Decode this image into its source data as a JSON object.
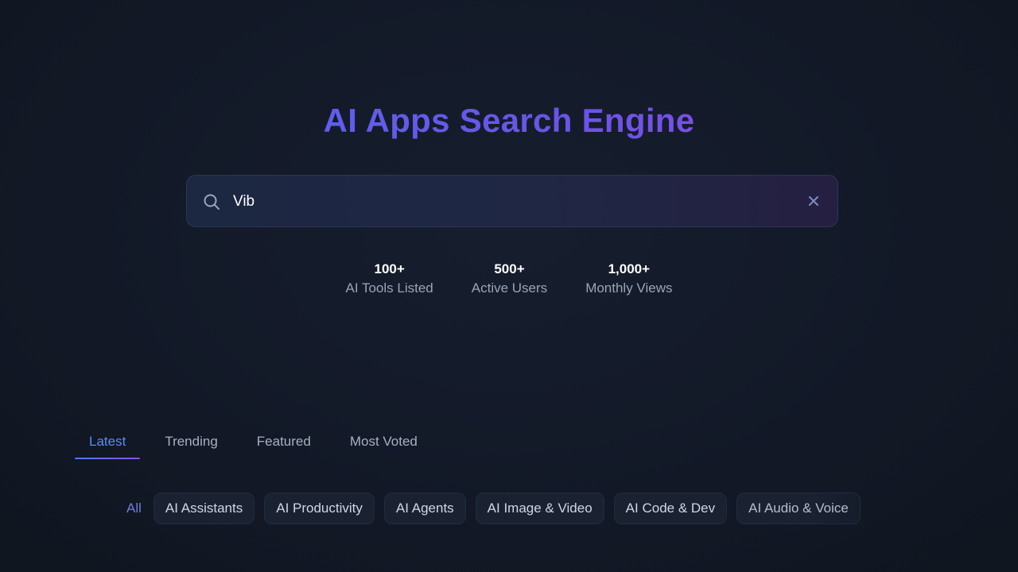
{
  "title": "AI Apps Search Engine",
  "search": {
    "value": "Vib",
    "icon": "search-icon",
    "clear_icon": "close-icon"
  },
  "stats": [
    {
      "value": "100+",
      "label": "AI Tools Listed"
    },
    {
      "value": "500+",
      "label": "Active Users"
    },
    {
      "value": "1,000+",
      "label": "Monthly Views"
    }
  ],
  "tabs": [
    {
      "label": "Latest",
      "active": true
    },
    {
      "label": "Trending"
    },
    {
      "label": "Featured"
    },
    {
      "label": "Most Voted"
    }
  ],
  "categories": [
    {
      "label": "All",
      "active": true
    },
    {
      "label": "AI Assistants"
    },
    {
      "label": "AI Productivity"
    },
    {
      "label": "AI Agents"
    },
    {
      "label": "AI Image & Video"
    },
    {
      "label": "AI Code & Dev"
    },
    {
      "label": "AI Audio & Voice"
    }
  ],
  "colors": {
    "background": "#131a28",
    "accent": "#5b8cf5",
    "title_gradient_start": "#4f6cf0",
    "title_gradient_end": "#9b44e6"
  }
}
